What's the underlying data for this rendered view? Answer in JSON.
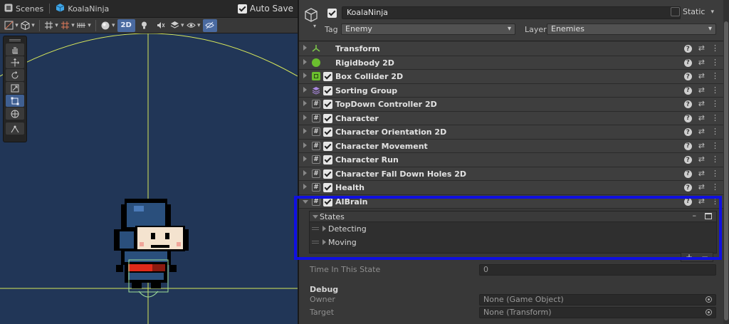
{
  "scene": {
    "tabs": [
      {
        "label": "Scenes",
        "icon": "scenes-icon"
      },
      {
        "label": "KoalaNinja",
        "icon": "prefab-cube-icon"
      }
    ],
    "auto_save_label": "Auto Save",
    "auto_save_checked": true,
    "toggle_2d_label": "2D",
    "tools": [
      "hand-tool-icon",
      "move-tool-icon",
      "rotate-tool-icon",
      "scale-tool-icon",
      "rect-tool-icon",
      "transform-tool-icon",
      "custom-editor-tool-icon"
    ],
    "active_tool": "rect-tool-icon",
    "viewport_bg": "#213657",
    "gizmo_color": "#d8e85a"
  },
  "inspector": {
    "object_name": "KoalaNinja",
    "active_checked": true,
    "static_label": "Static",
    "tag_label": "Tag",
    "tag_value": "Enemy",
    "layer_label": "Layer",
    "layer_value": "Enemies",
    "components": [
      {
        "name": "Transform",
        "icon": "transform-icon",
        "has_checkbox": false
      },
      {
        "name": "Rigidbody 2D",
        "icon": "rigidbody-icon",
        "has_checkbox": false
      },
      {
        "name": "Box Collider 2D",
        "icon": "box-collider-icon",
        "has_checkbox": true
      },
      {
        "name": "Sorting Group",
        "icon": "sorting-group-icon",
        "has_checkbox": true
      },
      {
        "name": "TopDown Controller 2D",
        "icon": "script-icon",
        "has_checkbox": true
      },
      {
        "name": "Character",
        "icon": "script-icon",
        "has_checkbox": true
      },
      {
        "name": "Character Orientation 2D",
        "icon": "script-icon",
        "has_checkbox": true
      },
      {
        "name": "Character Movement",
        "icon": "script-icon",
        "has_checkbox": true
      },
      {
        "name": "Character Run",
        "icon": "script-icon",
        "has_checkbox": true
      },
      {
        "name": "Character Fall Down Holes 2D",
        "icon": "script-icon",
        "has_checkbox": true
      },
      {
        "name": "Health",
        "icon": "script-icon",
        "has_checkbox": true
      },
      {
        "name": "AIBrain",
        "icon": "script-icon",
        "has_checkbox": true,
        "expanded": true
      }
    ],
    "states_label": "States",
    "states": [
      "Detecting",
      "Moving"
    ],
    "time_in_state_label": "Time In This State",
    "time_in_state_value": "0",
    "debug_label": "Debug",
    "owner_label": "Owner",
    "owner_value": "None (Game Object)",
    "target_label": "Target",
    "target_value": "None (Transform)",
    "highlight_color": "#1010e0"
  }
}
